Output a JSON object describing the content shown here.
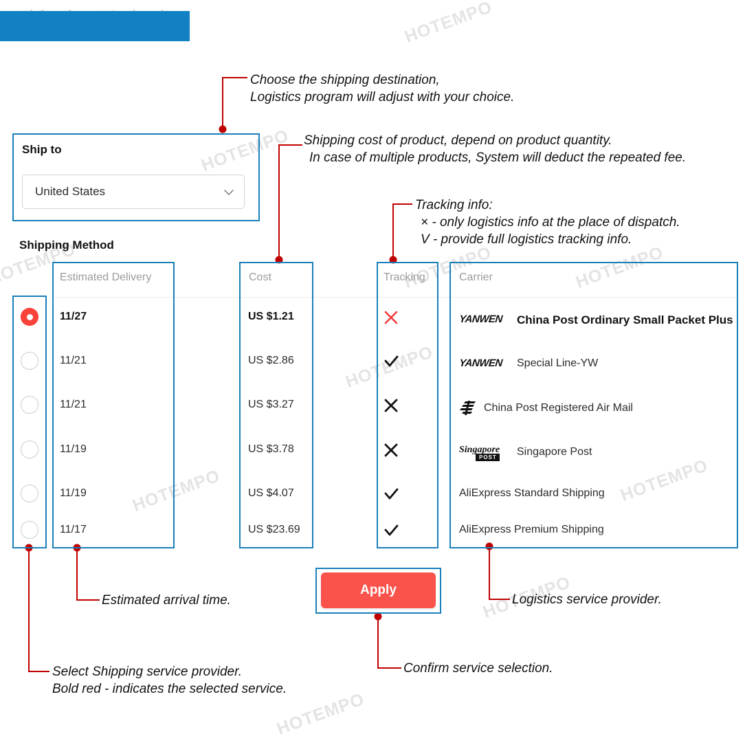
{
  "title": "Shipping Method",
  "ship_to": {
    "label": "Ship to",
    "selected_country": "United States",
    "chevron_icon": "chevron-down-icon"
  },
  "section_heading": "Shipping Method",
  "table": {
    "headers": {
      "delivery": "Estimated Delivery",
      "cost": "Cost",
      "tracking": "Tracking",
      "carrier": "Carrier"
    },
    "rows": [
      {
        "selected": true,
        "delivery": "11/27",
        "cost": "US $1.21",
        "tracking": "x",
        "tracking_color": "#ef3b3b",
        "carrier_logo": "yanwen-logo",
        "carrier_logo_text": "YANWEN",
        "carrier": "China Post Ordinary Small Packet Plus"
      },
      {
        "selected": false,
        "delivery": "11/21",
        "cost": "US $2.86",
        "tracking": "check",
        "tracking_color": "#111111",
        "carrier_logo": "yanwen-logo",
        "carrier_logo_text": "YANWEN",
        "carrier": "Special Line-YW"
      },
      {
        "selected": false,
        "delivery": "11/21",
        "cost": "US $3.27",
        "tracking": "x",
        "tracking_color": "#111111",
        "carrier_logo": "china-post-logo",
        "carrier_logo_text": "",
        "carrier": "China Post Registered Air Mail"
      },
      {
        "selected": false,
        "delivery": "11/19",
        "cost": "US $3.78",
        "tracking": "x",
        "tracking_color": "#111111",
        "carrier_logo": "singapore-post-logo",
        "carrier_logo_text": "Singapore",
        "carrier_logo_badge": "POST",
        "carrier": "Singapore Post"
      },
      {
        "selected": false,
        "delivery": "11/19",
        "cost": "US $4.07",
        "tracking": "check",
        "tracking_color": "#111111",
        "carrier_logo": "none",
        "carrier_logo_text": "",
        "carrier": "AliExpress Standard Shipping"
      },
      {
        "selected": false,
        "delivery": "11/17",
        "cost": "US $23.69",
        "tracking": "check",
        "tracking_color": "#111111",
        "carrier_logo": "none",
        "carrier_logo_text": "",
        "carrier": "AliExpress Premium Shipping"
      }
    ]
  },
  "apply_button": "Apply",
  "annotations": {
    "destination_l1": "Choose the shipping destination,",
    "destination_l2": "Logistics program will adjust with your choice.",
    "cost_l1": "Shipping cost of product, depend on product quantity.",
    "cost_l2": "In case of multiple products, System will deduct the repeated fee.",
    "tracking_l1": "Tracking info:",
    "tracking_l2": "× - only logistics info at the place of dispatch.",
    "tracking_l3": "V - provide full logistics tracking info.",
    "arrival": "Estimated arrival time.",
    "provider": "Logistics service provider.",
    "select_l1": "Select Shipping service provider.",
    "select_l2": "Bold red - indicates the selected service.",
    "confirm": "Confirm service selection."
  },
  "watermark_text": "HOTEMPO",
  "colors": {
    "title_bar": "#1281c4",
    "highlight_border": "#1a7fba",
    "leader_line": "#c00000",
    "apply_bg": "#f9534c",
    "selected_radio": "#f9423a",
    "tracking_x_selected": "#ef3b3b"
  }
}
